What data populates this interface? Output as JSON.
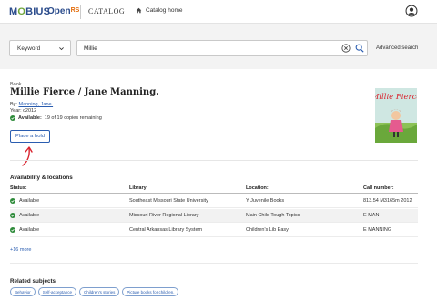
{
  "header": {
    "logo_mobius": "MOBIUS",
    "logo_openrs": "OpenRS",
    "catalog_label": "CATALOG",
    "home_label": "Catalog home"
  },
  "search": {
    "scope_value": "Keyword",
    "query_value": "Millie",
    "advanced_label": "Advanced search"
  },
  "record": {
    "type": "Book",
    "title": "Millie Fierce / Jane Manning.",
    "by_label": "By:",
    "author": "Manning, Jane.",
    "year": "Year: c2012",
    "availability_label": "Available:",
    "availability_text": "19 of 19 copies remaining",
    "hold_button": "Place a hold",
    "cover_title": "Millie Fierce"
  },
  "availability": {
    "heading": "Availability & locations",
    "columns": [
      "Status:",
      "Library:",
      "Location:",
      "Call number:"
    ],
    "rows": [
      {
        "status": "Available",
        "library": "Southeast Missouri State University",
        "location": "Y Juvenile Books",
        "call": "813.54 M3165m 2012"
      },
      {
        "status": "Available",
        "library": "Missouri River Regional Library",
        "location": "Main Child Tough Topics",
        "call": "E MAN"
      },
      {
        "status": "Available",
        "library": "Central Arkansas Library System",
        "location": "Children's Lib Easy",
        "call": "E MANNING"
      }
    ],
    "more_link": "+16 more"
  },
  "related": {
    "heading": "Related subjects",
    "subjects": [
      "Behavior",
      "Self-acceptance",
      "Children's stories",
      "Picture books for children."
    ]
  },
  "colors": {
    "link": "#2a5db0",
    "available_green": "#2e8b3a",
    "annotation_arrow": "#d9232e"
  }
}
